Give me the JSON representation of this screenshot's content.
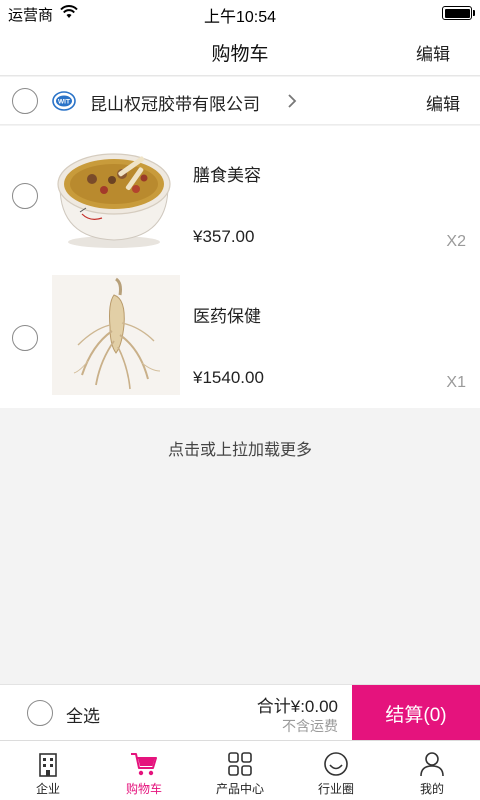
{
  "status_bar": {
    "carrier": "运营商",
    "time": "上午10:54"
  },
  "nav": {
    "title": "购物车",
    "edit": "编辑"
  },
  "shop": {
    "name": "昆山权冠胶带有限公司",
    "edit": "编辑",
    "logo_text": "WIT"
  },
  "items": [
    {
      "name": "膳食美容",
      "price": "¥357.00",
      "qty": "X2",
      "image": "herbal-soup-bowl"
    },
    {
      "name": "医药保健",
      "price": "¥1540.00",
      "qty": "X1",
      "image": "ginseng-root"
    }
  ],
  "load_more": "点击或上拉加载更多",
  "checkout": {
    "select_all": "全选",
    "total": "合计¥:0.00",
    "shipping_note": "不含运费",
    "pay_button": "结算(0)"
  },
  "tabs": [
    {
      "label": "企业",
      "icon": "building-icon"
    },
    {
      "label": "购物车",
      "icon": "cart-icon",
      "active": true
    },
    {
      "label": "产品中心",
      "icon": "grid-icon"
    },
    {
      "label": "行业圈",
      "icon": "smile-icon"
    },
    {
      "label": "我的",
      "icon": "person-icon"
    }
  ],
  "colors": {
    "accent": "#e5137d",
    "background": "#f3f3f3"
  }
}
